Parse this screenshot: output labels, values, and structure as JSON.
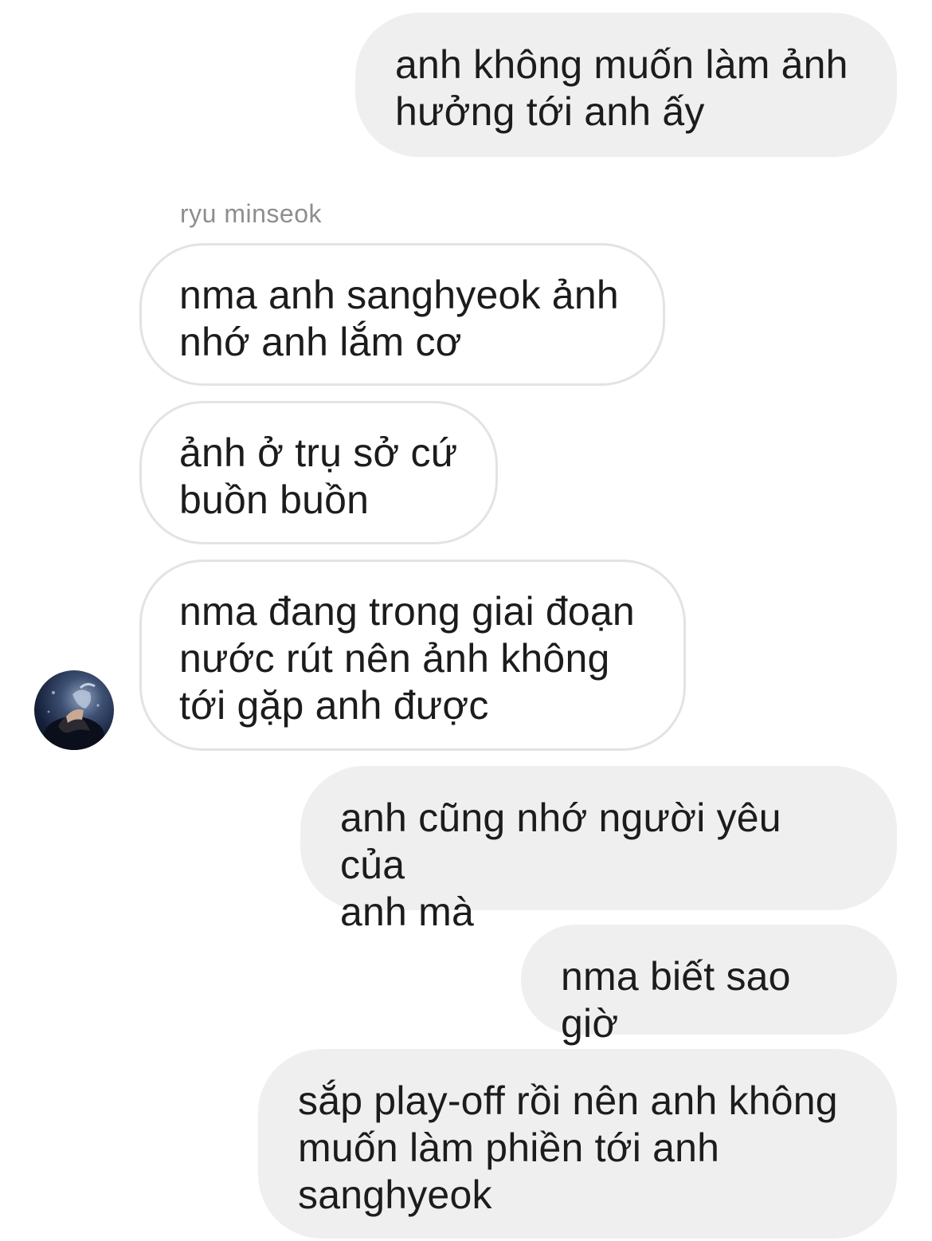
{
  "thread": {
    "sender_name": "ryu minseok",
    "messages": [
      {
        "from": "me",
        "text": "anh không muốn làm ảnh\nhưởng tới anh ấy"
      },
      {
        "from": "them",
        "text": "nma anh sanghyeok ảnh\nnhớ anh lắm cơ"
      },
      {
        "from": "them",
        "text": "ảnh ở trụ sở cứ\nbuồn buồn"
      },
      {
        "from": "them",
        "text": "nma đang trong giai đoạn\nnước rút nên ảnh không\ntới gặp anh được"
      },
      {
        "from": "me",
        "text": "anh cũng nhớ người yêu của\nanh mà"
      },
      {
        "from": "me",
        "text": "nma biết sao giờ"
      },
      {
        "from": "me",
        "text": "sắp play-off rồi nên anh không\nmuốn làm phiền tới anh\nsanghyeok"
      }
    ]
  },
  "colors": {
    "outgoing_bubble": "#efefef",
    "incoming_border": "#e3e3e3",
    "sender_name": "#8e8e8e",
    "text": "#1c1c1c"
  },
  "icons": {
    "avatar": "user-avatar-photo"
  }
}
